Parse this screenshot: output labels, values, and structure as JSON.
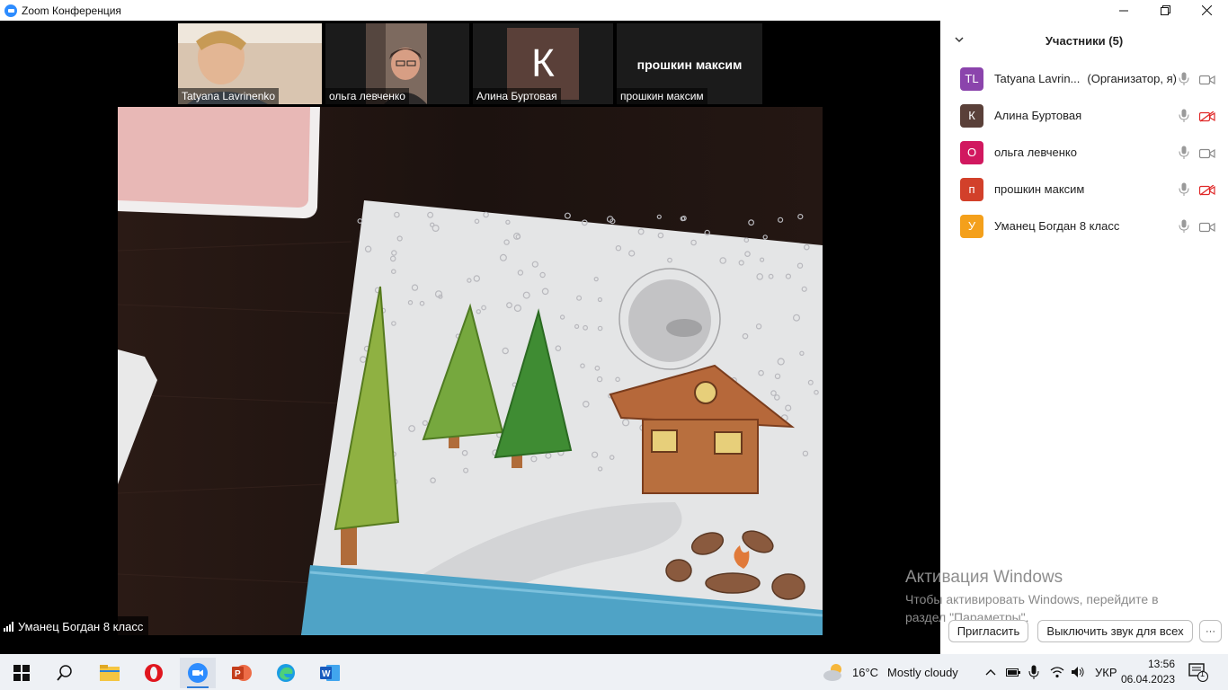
{
  "window": {
    "title": "Zoom Конференция",
    "controls": {
      "minimize": "—",
      "maximize": "❐",
      "close": "✕"
    }
  },
  "thumbnails": [
    {
      "name": "Tatyana Lavrinenko"
    },
    {
      "name": "ольга левченко"
    },
    {
      "name": "Алина Буртовая",
      "avatar_letter": "К",
      "avatar_color": "#5a4039"
    },
    {
      "name": "прошкин максим",
      "display_text": "прошкин максим"
    }
  ],
  "active_speaker": {
    "name": "Уманец Богдан 8 класс"
  },
  "participants_panel": {
    "title": "Участники (5)",
    "participants": [
      {
        "initials": "TL",
        "color": "#8b44ac",
        "name": "Tatyana Lavrin...",
        "role": "(Организатор, я)",
        "video_off": false
      },
      {
        "initials": "К",
        "color": "#5a4039",
        "name": "Алина Буртовая",
        "role": "",
        "video_off": true
      },
      {
        "initials": "О",
        "color": "#d1185f",
        "name": "ольга левченко",
        "role": "",
        "video_off": false
      },
      {
        "initials": "п",
        "color": "#d2402a",
        "name": "прошкин максим",
        "role": "",
        "video_off": true
      },
      {
        "initials": "У",
        "color": "#f4a01b",
        "name": "Уманец Богдан 8 класс",
        "role": "",
        "video_off": false
      }
    ],
    "invite_label": "Пригласить",
    "mute_all_label": "Выключить звук для всех",
    "more_label": "···"
  },
  "activation_watermark": {
    "title": "Активация Windows",
    "line1": "Чтобы активировать Windows, перейдите в",
    "line2": "раздел \"Параметры\"."
  },
  "taskbar": {
    "apps": [
      "start-icon",
      "search-icon",
      "file-explorer-icon",
      "opera-icon",
      "zoom-icon",
      "powerpoint-icon",
      "edge-icon",
      "word-icon"
    ],
    "weather_temp": "16°C",
    "weather_text": "Mostly cloudy",
    "language": "УКР",
    "time": "13:56",
    "date": "06.04.2023",
    "notification_count": "1"
  }
}
